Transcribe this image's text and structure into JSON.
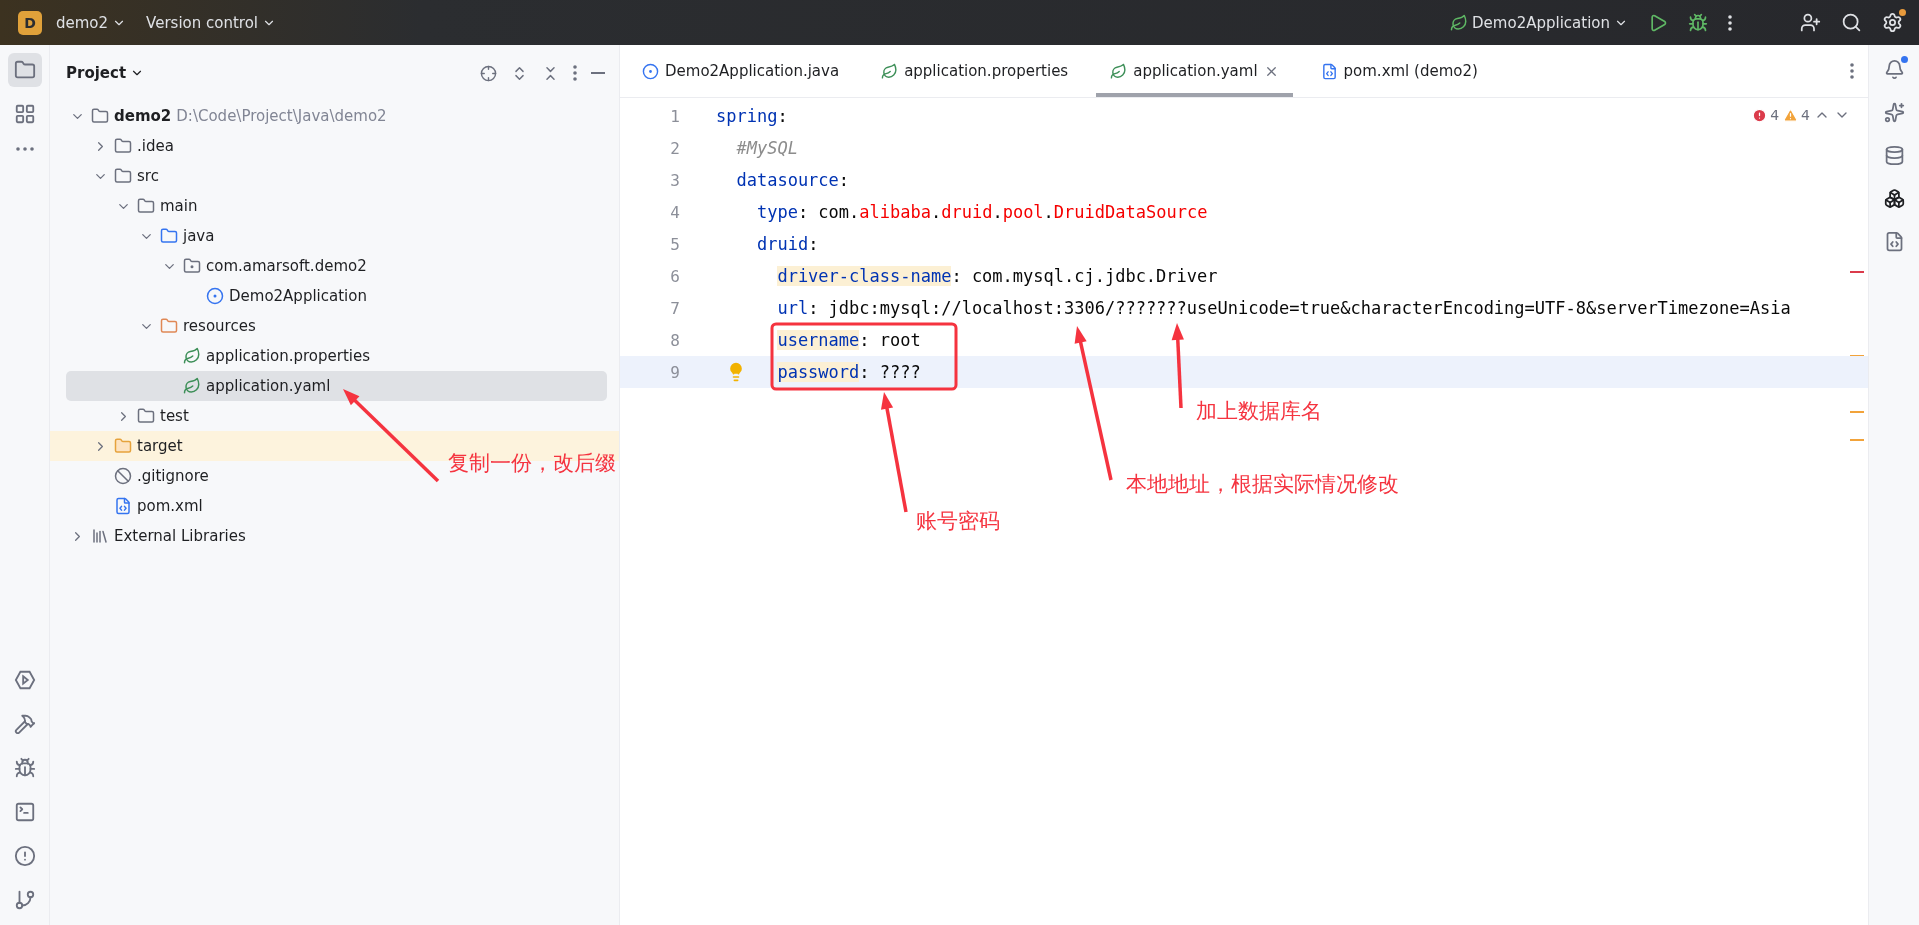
{
  "title_bar": {
    "project_badge": "D",
    "project": "demo2",
    "vcs": "Version control",
    "run_config": "Demo2Application"
  },
  "project_panel": {
    "title": "Project",
    "tree": [
      {
        "name": "demo2",
        "path": "D:\\Code\\Project\\Java\\demo2",
        "kind": "module",
        "expanded": true,
        "selected": false,
        "children": [
          {
            "name": ".idea",
            "kind": "folder",
            "expanded": false,
            "selected": false
          },
          {
            "name": "src",
            "kind": "folder",
            "expanded": true,
            "selected": false,
            "children": [
              {
                "name": "main",
                "kind": "folder",
                "expanded": true,
                "selected": false,
                "children": [
                  {
                    "name": "java",
                    "kind": "source",
                    "expanded": true,
                    "selected": false,
                    "children": [
                      {
                        "name": "com.amarsoft.demo2",
                        "kind": "package",
                        "expanded": true,
                        "selected": false,
                        "children": [
                          {
                            "name": "Demo2Application",
                            "kind": "spring_class",
                            "selected": false
                          }
                        ]
                      }
                    ]
                  },
                  {
                    "name": "resources",
                    "kind": "resources",
                    "expanded": true,
                    "selected": false,
                    "children": [
                      {
                        "name": "application.properties",
                        "kind": "spring_config",
                        "selected": false
                      },
                      {
                        "name": "application.yaml",
                        "kind": "spring_config",
                        "selected": true
                      }
                    ]
                  }
                ]
              },
              {
                "name": "test",
                "kind": "folder",
                "expanded": false,
                "selected": false
              }
            ]
          },
          {
            "name": "target",
            "kind": "excluded",
            "expanded": false,
            "selected": false
          },
          {
            "name": ".gitignore",
            "kind": "ignore",
            "selected": false
          },
          {
            "name": "pom.xml",
            "kind": "maven",
            "selected": false
          }
        ]
      },
      {
        "name": "External Libraries",
        "kind": "library",
        "expanded": false,
        "selected": false
      }
    ]
  },
  "editor": {
    "tabs": [
      {
        "label": "Demo2Application.java",
        "kind": "spring_class",
        "selected": false
      },
      {
        "label": "application.properties",
        "kind": "spring_config",
        "selected": false
      },
      {
        "label": "application.yaml",
        "kind": "spring_config",
        "selected": true
      },
      {
        "label": "pom.xml (demo2)",
        "kind": "maven",
        "selected": false
      }
    ],
    "inspections": {
      "errors": "4",
      "warnings": "4"
    },
    "lines": [
      {
        "number": "1",
        "current": false,
        "tokens": [
          {
            "text": "spring",
            "kind": "key"
          },
          {
            "text": ":",
            "kind": "plain"
          }
        ]
      },
      {
        "number": "2",
        "current": false,
        "tokens": [
          {
            "text": "#MySQL",
            "kind": "comment"
          }
        ]
      },
      {
        "number": "3",
        "current": false,
        "tokens": [
          {
            "text": "datasource",
            "kind": "key"
          },
          {
            "text": ":",
            "kind": "plain"
          }
        ]
      },
      {
        "number": "4",
        "current": false,
        "tokens": [
          {
            "text": "type",
            "kind": "key"
          },
          {
            "text": ": com.",
            "kind": "plain"
          },
          {
            "text": "alibaba",
            "kind": "error"
          },
          {
            "text": ".",
            "kind": "plain"
          },
          {
            "text": "druid",
            "kind": "error"
          },
          {
            "text": ".",
            "kind": "plain"
          },
          {
            "text": "pool",
            "kind": "error"
          },
          {
            "text": ".",
            "kind": "plain"
          },
          {
            "text": "DruidDataSource",
            "kind": "error"
          }
        ]
      },
      {
        "number": "5",
        "current": false,
        "tokens": [
          {
            "text": "druid",
            "kind": "key"
          },
          {
            "text": ":",
            "kind": "plain"
          }
        ]
      },
      {
        "number": "6",
        "current": false,
        "tokens": [
          {
            "text": "driver-class-name",
            "kind": "key",
            "highlighted": true
          },
          {
            "text": ": com.mysql.cj.jdbc.Driver",
            "kind": "plain"
          }
        ]
      },
      {
        "number": "7",
        "current": false,
        "tokens": [
          {
            "text": "url",
            "kind": "key"
          },
          {
            "text": ": jdbc:mysql://localhost:3306/???????useUnicode=true&characterEncoding=UTF-8&serverTimezone=Asia",
            "kind": "plain"
          }
        ]
      },
      {
        "number": "8",
        "current": false,
        "tokens": [
          {
            "text": "username",
            "kind": "key",
            "highlighted": true
          },
          {
            "text": ": root",
            "kind": "plain"
          }
        ]
      },
      {
        "number": "9",
        "current": true,
        "bulb": true,
        "tokens": [
          {
            "text": "password",
            "kind": "key",
            "highlighted": true
          },
          {
            "text": ": ????",
            "kind": "plain"
          }
        ]
      }
    ]
  },
  "annotations": [
    {
      "text": "复制一份，改后缀"
    },
    {
      "text": "加上数据库名"
    },
    {
      "text": "本地地址，根据实际情况修改"
    },
    {
      "text": "账号密码"
    }
  ]
}
